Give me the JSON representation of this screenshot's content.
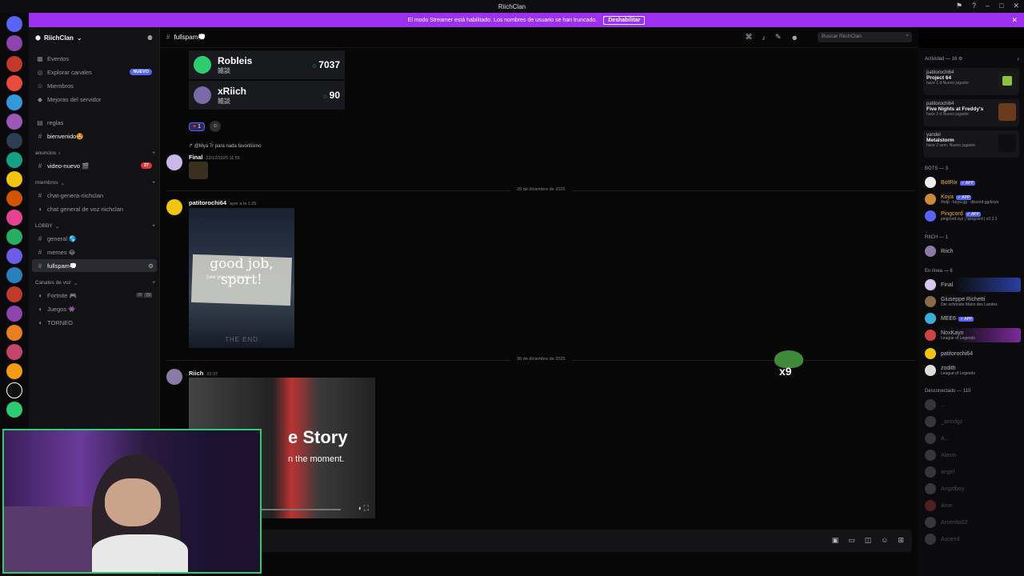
{
  "window": {
    "title": "RiichClan"
  },
  "streamer_banner": {
    "text": "El modo Streamer está habilitado. Los nombres de usuario se han truncado.",
    "button": "Deshabilitar"
  },
  "server": {
    "name": "RiichClan"
  },
  "channels": {
    "top": [
      {
        "label": "Eventos",
        "icon": "calendar-icon"
      },
      {
        "label": "Explorar canales",
        "icon": "compass-icon",
        "tag": "NUEVO"
      },
      {
        "label": "Miembros",
        "icon": "members-icon"
      },
      {
        "label": "Mejoras del servidor",
        "icon": "boost-icon"
      }
    ],
    "reglas": "reglas",
    "bienvenido": "bienvenido🤩",
    "cat_anuncios": "anuncios",
    "video_nuevo": "video-nuevo 🎬",
    "video_badge": "27",
    "cat_miembros": "miembros",
    "chat_genera": "chat-genera-riichclan",
    "chat_voz": "chat general de voz riichclan",
    "cat_lobby": "LOBBY",
    "general": "general 🌎",
    "memes": "memes 😂",
    "fullspam": "fullspam💭",
    "cat_voz": "Canales de voz",
    "fortnite": "Fortnite 🎮",
    "fortnite_counts": [
      "00",
      "29"
    ],
    "juegos": "Juegos 👾",
    "torneo": "TORNEO"
  },
  "header": {
    "channel": "fullspam💭",
    "search_placeholder": "Buscar RiichClan"
  },
  "leaderboard": [
    {
      "name": "Robleis",
      "sub": "雑談",
      "score": "7037"
    },
    {
      "name": "xRiich",
      "sub": "雑談",
      "score": "90"
    }
  ],
  "reaction": {
    "count": "1"
  },
  "reply": {
    "to": "@Mya 7r",
    "text": "para nada favoritismo"
  },
  "msg_final": {
    "user": "Final",
    "time": "22/12/2025 11:55"
  },
  "date1": "29 de diciembre de 2025",
  "msg_pat": {
    "user": "patitorochi64",
    "time": "ayer a la 1:25",
    "img_text": "good job, sport!",
    "img_sub": "(see you next week)",
    "img_end": "THE END"
  },
  "date2": "30 de diciembre de 2025",
  "msg_riich": {
    "user": "Riich",
    "time": "23:37",
    "img_title": "e Story",
    "img_sub": "n the moment."
  },
  "sticker": {
    "text": "x9"
  },
  "members": {
    "activity_header": "Actividad — 16",
    "activities": [
      {
        "user": "patitorochi64",
        "title": "Project 64",
        "detail": "hace 1 d  Nuevo jugador"
      },
      {
        "user": "patitorochi64",
        "title": "Five Nights at Freddy's",
        "detail": "hace 2 d  Nuevo jugador"
      },
      {
        "user": "yandel",
        "title": "Metalstorm",
        "detail": "hace 2 sem.  Nuevo jugador"
      }
    ],
    "bots_header": "BOTS — 3",
    "bots": [
      {
        "name": "BotRix",
        "status": ""
      },
      {
        "name": "Koya",
        "status": "/help · koya.gg · discord.gg/koya"
      },
      {
        "name": "Pingcord",
        "status": "pingcord.xyz | !pingcord | v2.2.1"
      }
    ],
    "app_label": "✓ APP",
    "riich_header": "RIICH — 1",
    "riich": "Riich",
    "online_header": "En línea — 6",
    "online": [
      {
        "name": "Final",
        "status": ""
      },
      {
        "name": "Giuseppe Richetti",
        "status": "Der schönste Mann des Landes"
      },
      {
        "name": "MEE6",
        "status": ""
      },
      {
        "name": "NoxKayn",
        "status": "League of Legends"
      },
      {
        "name": "patitorochi64",
        "status": ""
      },
      {
        "name": "zodith",
        "status": "League of Legends"
      }
    ],
    "offline_header": "Desconectado — 110",
    "offline": [
      "...",
      "_antrdgz",
      "A...",
      "Alexm",
      "angel",
      "Angelboy",
      "Aron",
      "Arsenito02",
      "Ascend"
    ]
  }
}
